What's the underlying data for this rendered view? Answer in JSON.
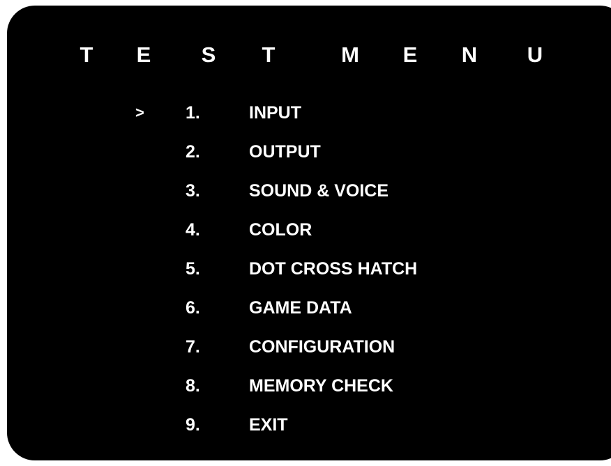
{
  "title": {
    "letters": [
      "T",
      "E",
      "S",
      "T",
      "M",
      "E",
      "N",
      "U"
    ]
  },
  "menu": {
    "cursor": ">",
    "items": [
      {
        "number": "1.",
        "label": "INPUT",
        "selected": true
      },
      {
        "number": "2.",
        "label": "OUTPUT",
        "selected": false
      },
      {
        "number": "3.",
        "label": "SOUND & VOICE",
        "selected": false
      },
      {
        "number": "4.",
        "label": "COLOR",
        "selected": false
      },
      {
        "number": "5.",
        "label": "DOT CROSS HATCH",
        "selected": false
      },
      {
        "number": "6.",
        "label": "GAME DATA",
        "selected": false
      },
      {
        "number": "7.",
        "label": "CONFIGURATION",
        "selected": false
      },
      {
        "number": "8.",
        "label": "MEMORY CHECK",
        "selected": false
      },
      {
        "number": "9.",
        "label": "EXIT",
        "selected": false
      }
    ]
  },
  "colors": {
    "background": "#000000",
    "text": "#ffffff"
  }
}
